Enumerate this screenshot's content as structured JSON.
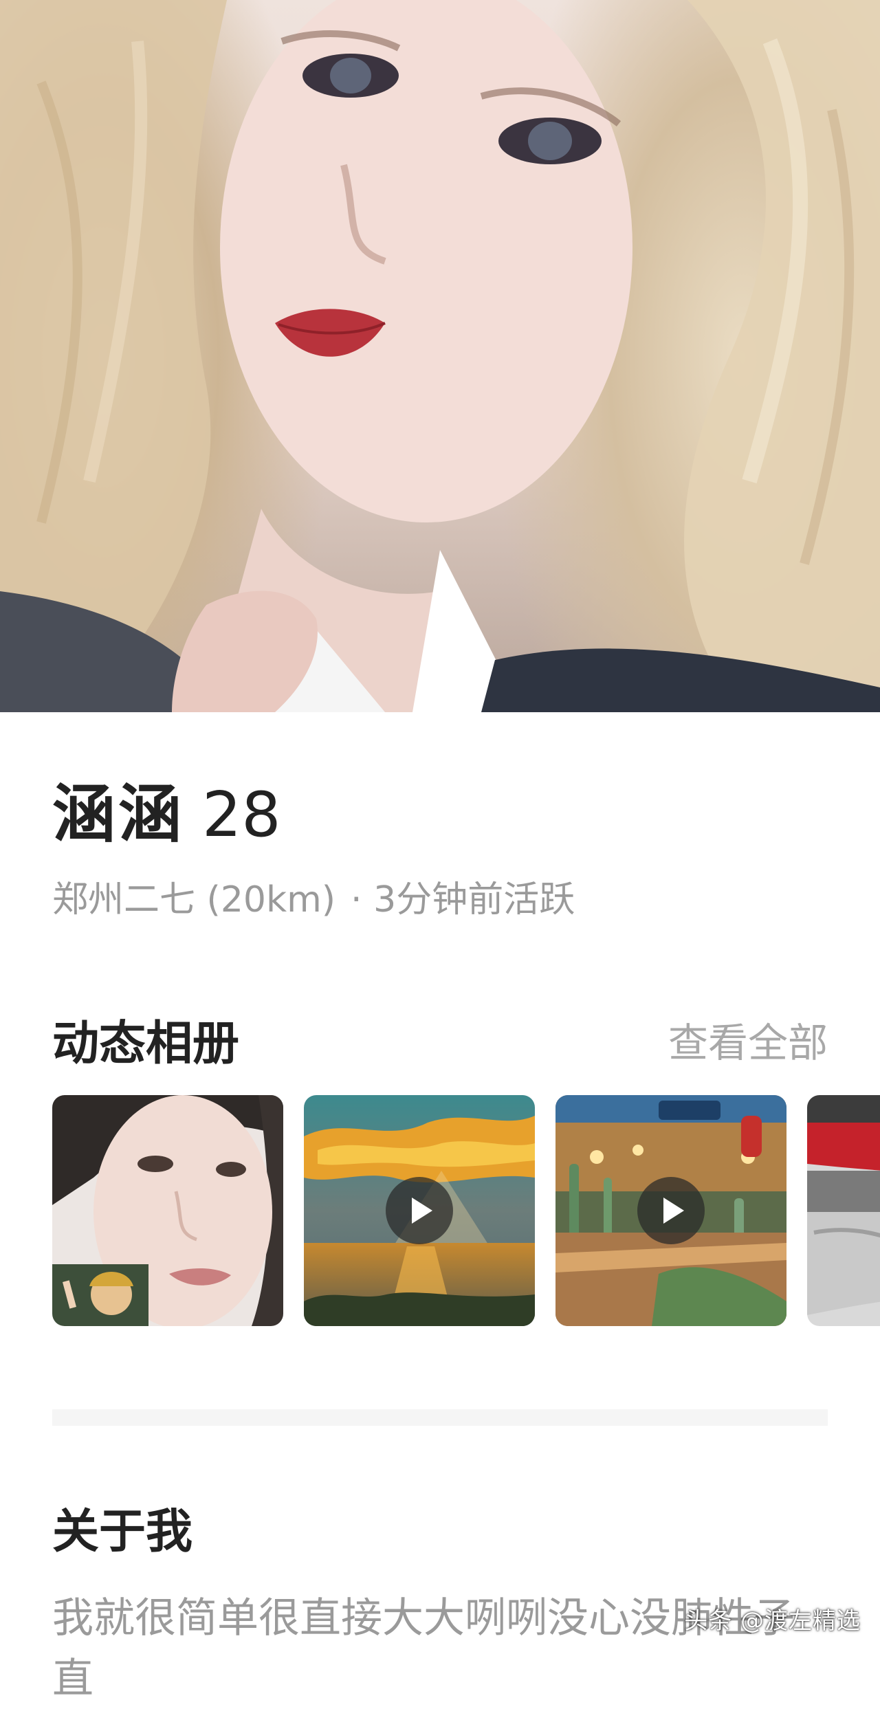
{
  "profile": {
    "name": "涵涵",
    "age": "28",
    "location": "郑州二七 (20km)",
    "active_status": "· 3分钟前活跃"
  },
  "album": {
    "title": "动态相册",
    "view_all_label": "查看全部",
    "items": [
      {
        "kind": "photo",
        "icon": "photo"
      },
      {
        "kind": "video",
        "icon": "play-icon"
      },
      {
        "kind": "video",
        "icon": "play-icon"
      },
      {
        "kind": "photo",
        "icon": "photo"
      }
    ]
  },
  "about": {
    "title": "关于我",
    "text": "我就很简单很直接大大咧咧没心没肺性子直"
  },
  "watermark": "头条 @渡左精选",
  "colors": {
    "primary_text": "#222222",
    "secondary_text": "#9a9a9a",
    "link_text": "#a8a8a8",
    "divider": "#f5f5f5"
  }
}
